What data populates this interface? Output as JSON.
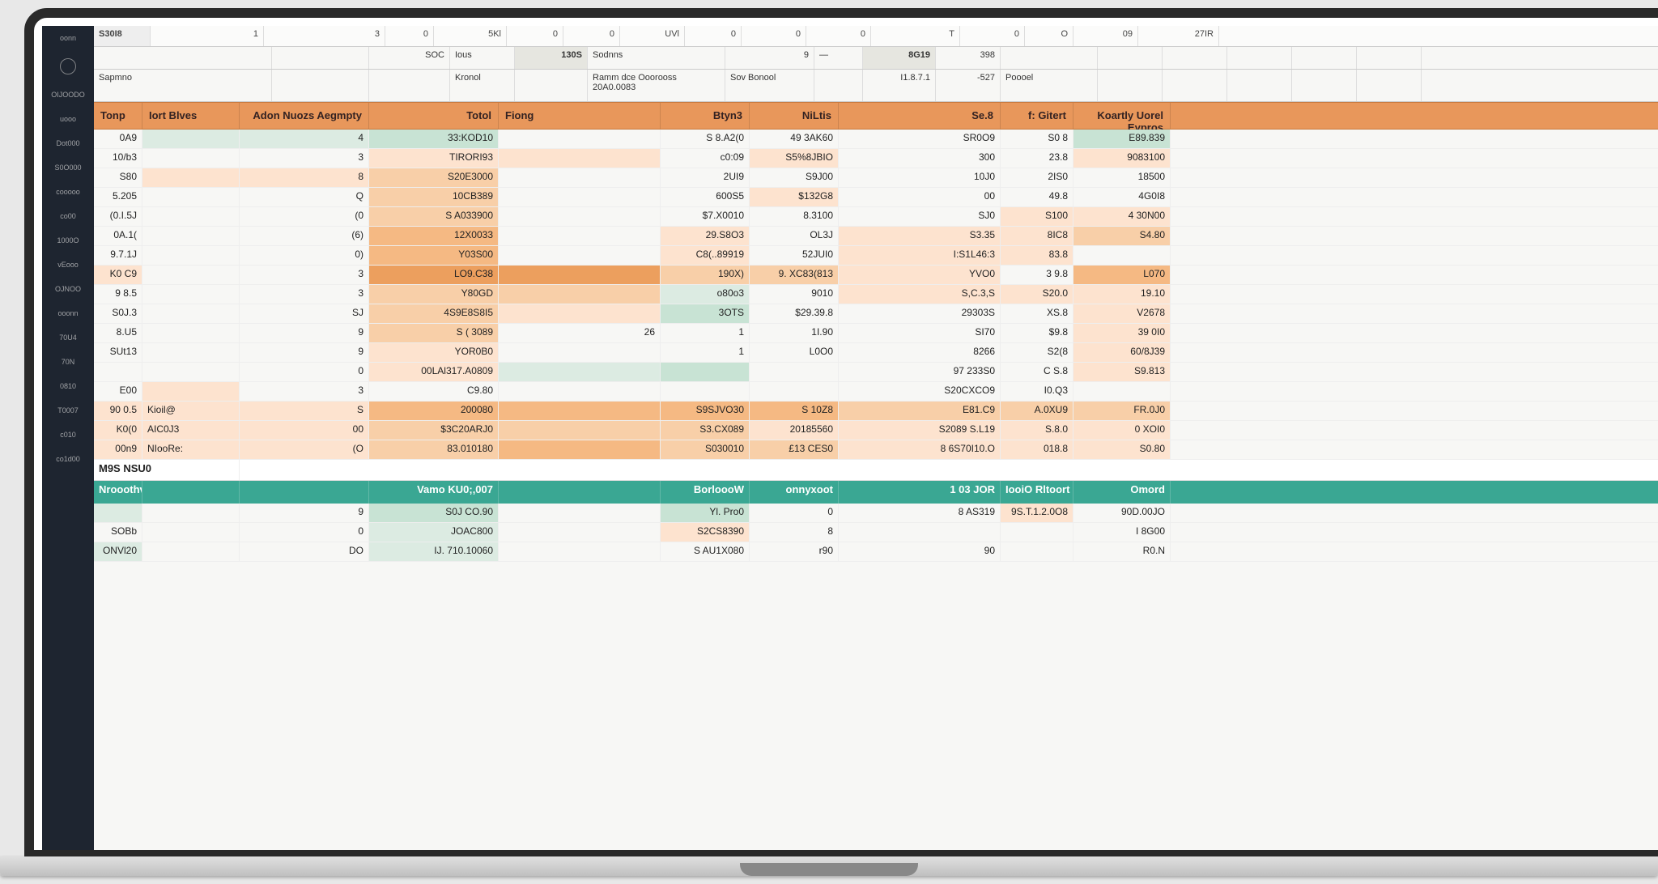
{
  "sidebar": {
    "items": [
      "oonn",
      "",
      "OIJOODO",
      "uooo",
      "Dot000",
      "S0O000",
      "cooooo",
      "co00",
      "1000O",
      "vEooo",
      "OJNOO",
      "ooonn",
      "70U4",
      "70N",
      "0810",
      "T0007",
      "c010",
      "co1d00"
    ]
  },
  "ruler": {
    "cells": [
      "S30I8",
      "1",
      "3",
      "0",
      "5Kl",
      "0",
      "0",
      "UVl",
      "0",
      "0",
      "0",
      "T",
      "0",
      "O",
      "09",
      "27IR"
    ]
  },
  "info1": {
    "cells": [
      "",
      "",
      "SOC",
      "Ious",
      "130S",
      "Sodnns",
      "9",
      "—",
      "8G19",
      "398",
      "",
      "",
      "",
      "",
      "",
      ""
    ]
  },
  "info2": {
    "cells": [
      "Sapmno",
      "",
      "",
      "Kronol",
      "",
      "Ramm dce Ooorooss 20A0.0083",
      "Sov  Bonool",
      "",
      "I1.8.7.1",
      "-527",
      "Poooel",
      "",
      "",
      "",
      "",
      ""
    ]
  },
  "columns": [
    "Tonp",
    "Iort Blves",
    "Adon Nuozs Aegmpty",
    "Totol",
    "Fiong",
    "Btyn3",
    "NiLtis",
    "Se.8",
    "f: Gitert",
    "Koartly Uorel Eypros"
  ],
  "rows": [
    {
      "c": [
        "0A9",
        "",
        "4",
        "33:KOD10",
        "",
        "S 8.A2(0",
        "49 3AK60",
        "SR0O9",
        "S0 8",
        "E89.839"
      ],
      "sh": [
        "",
        "sh-pale-gr",
        "sh-pale-gr",
        "sh-lt-gr",
        "",
        "",
        "",
        "",
        "",
        "sh-lt-gr"
      ]
    },
    {
      "c": [
        "10/b3",
        "",
        "3",
        "TIRORI93",
        "",
        "c0:09",
        "S5%8JBIO",
        "300",
        "23.8",
        "9083100"
      ],
      "sh": [
        "",
        "",
        "",
        "sh-pale-or",
        "sh-pale-or",
        "",
        "sh-pale-or",
        "",
        "",
        "sh-pale-or"
      ]
    },
    {
      "c": [
        "S80",
        "",
        "8",
        "S20E3000",
        "",
        "2UI9",
        "S9J00",
        "10J0",
        "2IS0",
        "18500"
      ],
      "sh": [
        "",
        "sh-pale-or",
        "sh-pale-or",
        "sh-lt-or",
        "",
        "",
        "",
        "",
        "",
        ""
      ]
    },
    {
      "c": [
        "5.205",
        "",
        "Q",
        "10CB389",
        "",
        "600S5",
        "$132G8",
        "00",
        "49.8",
        "4G0I8"
      ],
      "sh": [
        "",
        "",
        "",
        "sh-lt-or",
        "",
        "",
        "sh-pale-or",
        "",
        "",
        ""
      ]
    },
    {
      "c": [
        "(0.I.5J",
        "",
        "(0",
        "S A033900",
        "",
        "$7.X0010",
        "8.3100",
        "SJ0",
        "S100",
        "4 30N00"
      ],
      "sh": [
        "",
        "",
        "",
        "sh-lt-or",
        "",
        "",
        "",
        "",
        "sh-pale-or",
        "sh-pale-or"
      ]
    },
    {
      "c": [
        "0A.1(",
        "",
        "(6)",
        "12X0033",
        "",
        "29.S8O3",
        "OL3J",
        "S3.35",
        "8IC8",
        "S4.80"
      ],
      "sh": [
        "",
        "",
        "",
        "sh-mid-or",
        "",
        "sh-pale-or",
        "",
        "sh-pale-or",
        "sh-pale-or",
        "sh-lt-or"
      ]
    },
    {
      "c": [
        "9.7.1J",
        "",
        "0)",
        "Y03S00",
        "",
        "C8(..89919",
        "52JUI0",
        "I:S1L46:3",
        "83.8",
        ""
      ],
      "sh": [
        "",
        "",
        "",
        "sh-mid-or",
        "",
        "sh-pale-or",
        "",
        "sh-pale-or",
        "sh-pale-or",
        ""
      ]
    },
    {
      "c": [
        "K0 C9",
        "",
        "3",
        "LO9.C38",
        "",
        "190X)",
        "9. XC83(813",
        "YVO0",
        "3 9.8",
        "L070"
      ],
      "sh": [
        "sh-pale-or",
        "",
        "",
        "sh-dk-or",
        "sh-dk-or",
        "sh-lt-or",
        "sh-lt-or",
        "sh-pale-or",
        "",
        "sh-mid-or"
      ]
    },
    {
      "c": [
        "9 8.5",
        "",
        "3",
        "Y80GD",
        "",
        "o80o3",
        "9010",
        "S,C.3,S",
        "S20.0",
        "19.10"
      ],
      "sh": [
        "",
        "",
        "",
        "sh-lt-or",
        "sh-lt-or",
        "sh-pale-gr",
        "",
        "sh-pale-or",
        "sh-pale-or",
        "sh-pale-or"
      ]
    },
    {
      "c": [
        "S0J.3",
        "",
        "SJ",
        "4S9E8S8I5",
        "",
        "3OTS",
        "$29.39.8",
        "29303S",
        "XS.8",
        "V2678"
      ],
      "sh": [
        "",
        "",
        "",
        "sh-lt-or",
        "sh-pale-or",
        "sh-lt-gr",
        "",
        "",
        "",
        "sh-pale-or"
      ]
    },
    {
      "c": [
        "8.U5",
        "",
        "9",
        "S ( 3089",
        "26",
        "1",
        "1I.90",
        "SI70",
        "$9.8",
        "39 0I0"
      ],
      "sh": [
        "",
        "",
        "",
        "sh-lt-or",
        "",
        "",
        "",
        "",
        "",
        "sh-pale-or"
      ]
    },
    {
      "c": [
        "SUt13",
        "",
        "9",
        "YOR0B0",
        "",
        "1",
        "L0O0",
        "8266",
        "S2(8",
        "60/8J39"
      ],
      "sh": [
        "",
        "",
        "",
        "sh-pale-or",
        "",
        "",
        "",
        "",
        "",
        "sh-pale-or"
      ]
    },
    {
      "c": [
        "",
        "",
        "0",
        "00LAl317.A0809",
        "",
        "",
        "",
        "97 233S0",
        "C S.8",
        "S9.813"
      ],
      "sh": [
        "",
        "",
        "",
        "sh-pale-or",
        "sh-pale-gr",
        "sh-lt-gr",
        "",
        "",
        "",
        "sh-pale-or"
      ]
    },
    {
      "c": [
        "E00",
        "",
        "3",
        "C9.80",
        "",
        "",
        "",
        "S20CXCO9",
        "I0.Q3",
        ""
      ],
      "sh": [
        "",
        "sh-pale-or",
        "",
        "",
        "",
        "",
        "",
        "",
        "",
        ""
      ]
    },
    {
      "c": [
        "90 0.5",
        "Kioil@",
        "S",
        "200080",
        "",
        "S9SJVO30",
        "S 10Z8",
        "E81.C9",
        "A.0XU9",
        "FR.0J0"
      ],
      "sh": [
        "sh-pale-or",
        "sh-pale-or",
        "sh-pale-or",
        "sh-mid-or",
        "sh-mid-or",
        "sh-mid-or",
        "sh-mid-or",
        "sh-lt-or",
        "sh-lt-or",
        "sh-lt-or"
      ]
    },
    {
      "c": [
        "K0(0",
        "AIC0J3",
        "00",
        "$3C20ARJ0",
        "",
        "S3.CX089",
        "20185560",
        "S2089 S.L19",
        "S.8.0",
        "0 XOI0"
      ],
      "sh": [
        "sh-pale-or",
        "sh-pale-or",
        "sh-pale-or",
        "sh-lt-or",
        "sh-lt-or",
        "sh-lt-or",
        "sh-pale-or",
        "sh-pale-or",
        "sh-pale-or",
        "sh-pale-or"
      ]
    },
    {
      "c": [
        "00n9",
        "NIooRe:",
        "(O",
        "83.010180",
        "",
        "S030010",
        "£13 CES0",
        "8 6S70I10.O",
        "018.8",
        "S0.80"
      ],
      "sh": [
        "sh-pale-or",
        "sh-pale-or",
        "sh-pale-or",
        "sh-lt-or",
        "sh-mid-or",
        "sh-lt-or",
        "sh-lt-or",
        "sh-pale-or",
        "sh-pale-or",
        "sh-pale-or"
      ]
    }
  ],
  "section_label": "M9S NSU0",
  "teal_band": [
    "Nrooothv",
    "",
    "",
    "Vamo KU0;,007",
    "",
    "BorloooW",
    "onnyxoot",
    "1 03 JOR",
    "IooiO Rltoort",
    "Omord"
  ],
  "rows2": [
    {
      "c": [
        "",
        "",
        "9",
        "S0J CO.90",
        "",
        "Yl. Pro0",
        "0",
        "8 AS319",
        "9S.T.1.2.0O8",
        "90D.00JO"
      ],
      "sh": [
        "sh-pale-gr",
        "",
        "",
        "sh-lt-gr",
        "",
        "sh-lt-gr",
        "",
        "",
        "sh-pale-or",
        ""
      ]
    },
    {
      "c": [
        "SOBb",
        "",
        "0",
        "JOAC800",
        "",
        "S2CS8390",
        "8",
        "",
        "",
        "I 8G00"
      ],
      "sh": [
        "",
        "",
        "",
        "sh-pale-gr",
        "",
        "sh-pale-or",
        "",
        "",
        "",
        ""
      ]
    },
    {
      "c": [
        "ONVl20",
        "",
        "DO",
        "IJ. 710.10060",
        "",
        "S AU1X080",
        "r90",
        "90",
        "",
        "R0.N"
      ],
      "sh": [
        "sh-pale-gr",
        "",
        "",
        "sh-pale-gr",
        "",
        "",
        "",
        "",
        "",
        ""
      ]
    }
  ]
}
